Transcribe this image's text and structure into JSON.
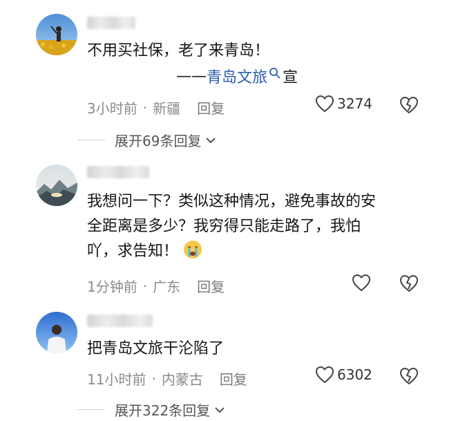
{
  "comments": [
    {
      "text": "不用买社保，老了来青岛！",
      "signature": {
        "dash": "——",
        "link": "青岛文旅",
        "suffix": "宣"
      },
      "time": "3小时前",
      "location": "新疆",
      "reply": "回复",
      "likes": "3274",
      "expand": "展开69条回复"
    },
    {
      "lines": [
        "我想问一下？类似这种情况，避免事故的安",
        "全距离是多少？我穷得只能走路了，我怕",
        "吖，求告知！"
      ],
      "emoji": "crying-face",
      "time": "1分钟前",
      "location": "广东",
      "reply": "回复",
      "likes": ""
    },
    {
      "text": "把青岛文旅干沦陷了",
      "time": "11小时前",
      "location": "内蒙古",
      "reply": "回复",
      "likes": "6302",
      "expand": "展开322条回复"
    }
  ],
  "colors": {
    "link": "#2a5db0",
    "meta": "#8a8a8a",
    "icon": "#333333"
  },
  "icons": [
    "heart-outline-icon",
    "broken-heart-icon",
    "search-icon",
    "chevron-down-icon"
  ]
}
